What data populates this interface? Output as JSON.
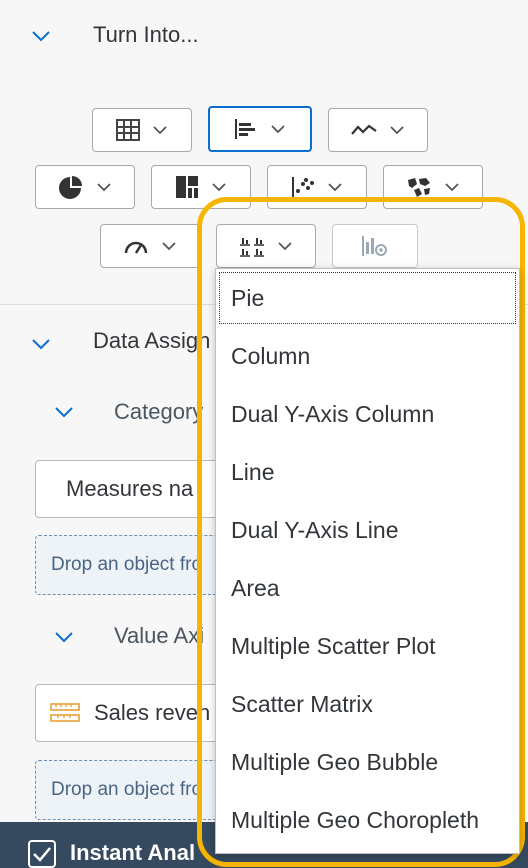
{
  "turn_into": {
    "label": "Turn Into..."
  },
  "data_assignment": {
    "label": "Data Assign"
  },
  "category": {
    "label": "Category"
  },
  "measures_field": {
    "value": "Measures na"
  },
  "drop_object_1": {
    "text": "Drop an object fro"
  },
  "value_axis": {
    "label": "Value Axi"
  },
  "sales_field": {
    "value": "Sales reven"
  },
  "drop_object_2": {
    "text": "Drop an object fro"
  },
  "bottom_bar": {
    "label": "Instant Anal"
  },
  "dropdown": {
    "options": [
      "Pie",
      "Column",
      "Dual Y-Axis Column",
      "Line",
      "Dual Y-Axis Line",
      "Area",
      "Multiple Scatter Plot",
      "Scatter Matrix",
      "Multiple Geo Bubble",
      "Multiple Geo Choropleth"
    ]
  },
  "colors": {
    "accent": "#0a6ed1",
    "highlight": "#f6b500",
    "text": "#32363a",
    "bottom_bar": "#354a5f",
    "ruler_icon": "#e8a13a"
  },
  "icons": [
    "table-icon",
    "bar-chart-icon",
    "line-chart-icon",
    "pie-chart-icon",
    "treemap-icon",
    "scatter-icon",
    "geo-map-icon",
    "gauge-icon",
    "multiples-icon",
    "chart-settings-icon",
    "ruler-icon"
  ]
}
